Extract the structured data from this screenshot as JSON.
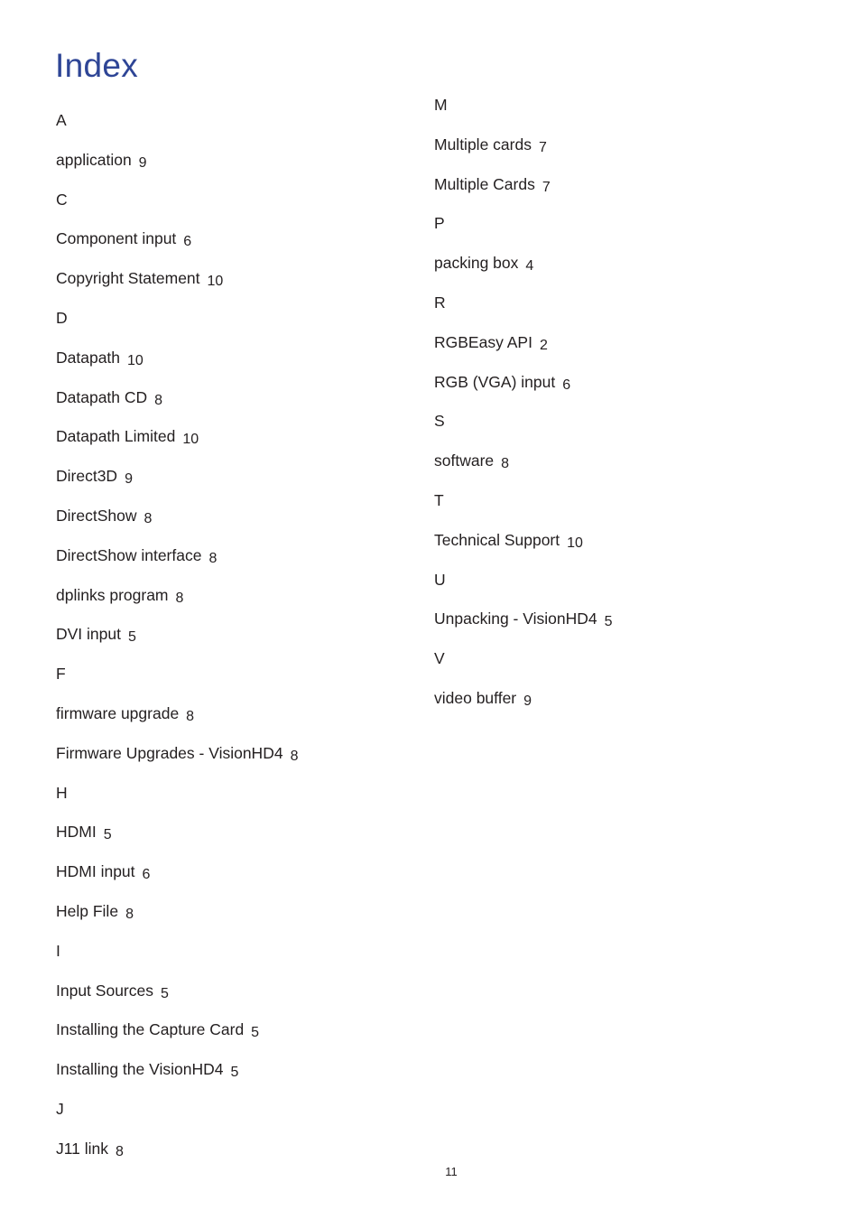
{
  "title": "Index",
  "page_number": "11",
  "columns": [
    {
      "entries": [
        {
          "type": "letter",
          "text": "A"
        },
        {
          "type": "term",
          "text": "application",
          "page": "9"
        },
        {
          "type": "letter",
          "text": "C"
        },
        {
          "type": "term",
          "text": "Component input",
          "page": "6"
        },
        {
          "type": "term",
          "text": "Copyright Statement",
          "page": "10"
        },
        {
          "type": "letter",
          "text": "D"
        },
        {
          "type": "term",
          "text": "Datapath",
          "page": "10"
        },
        {
          "type": "term",
          "text": "Datapath CD",
          "page": "8"
        },
        {
          "type": "term",
          "text": "Datapath Limited",
          "page": "10"
        },
        {
          "type": "term",
          "text": "Direct3D",
          "page": "9"
        },
        {
          "type": "term",
          "text": "DirectShow",
          "page": "8"
        },
        {
          "type": "term",
          "text": "DirectShow interface",
          "page": "8"
        },
        {
          "type": "term",
          "text": "dplinks program",
          "page": "8"
        },
        {
          "type": "term",
          "text": "DVI input",
          "page": "5"
        },
        {
          "type": "letter",
          "text": "F"
        },
        {
          "type": "term",
          "text": "firmware upgrade",
          "page": "8"
        },
        {
          "type": "term",
          "text": "Firmware Upgrades - VisionHD4",
          "page": "8"
        },
        {
          "type": "letter",
          "text": "H"
        },
        {
          "type": "term",
          "text": "HDMI",
          "page": "5"
        },
        {
          "type": "term",
          "text": "HDMI input",
          "page": "6"
        },
        {
          "type": "term",
          "text": "Help File",
          "page": "8"
        },
        {
          "type": "letter",
          "text": "I"
        },
        {
          "type": "term",
          "text": "Input Sources",
          "page": "5"
        },
        {
          "type": "term",
          "text": "Installing the Capture Card",
          "page": "5"
        },
        {
          "type": "term",
          "text": "Installing the VisionHD4",
          "page": "5"
        },
        {
          "type": "letter",
          "text": "J"
        },
        {
          "type": "term",
          "text": "J11 link",
          "page": "8"
        }
      ]
    },
    {
      "entries": [
        {
          "type": "letter",
          "text": "M"
        },
        {
          "type": "term",
          "text": "Multiple cards",
          "page": "7"
        },
        {
          "type": "term",
          "text": "Multiple Cards",
          "page": "7"
        },
        {
          "type": "letter",
          "text": "P"
        },
        {
          "type": "term",
          "text": "packing box",
          "page": "4"
        },
        {
          "type": "letter",
          "text": "R"
        },
        {
          "type": "term",
          "text": "RGBEasy API",
          "page": "2"
        },
        {
          "type": "term",
          "text": "RGB (VGA) input",
          "page": "6"
        },
        {
          "type": "letter",
          "text": "S"
        },
        {
          "type": "term",
          "text": "software",
          "page": "8"
        },
        {
          "type": "letter",
          "text": "T"
        },
        {
          "type": "term",
          "text": "Technical Support",
          "page": "10"
        },
        {
          "type": "letter",
          "text": "U"
        },
        {
          "type": "term",
          "text": "Unpacking - VisionHD4",
          "page": "5"
        },
        {
          "type": "letter",
          "text": "V"
        },
        {
          "type": "term",
          "text": "video buffer",
          "page": "9"
        }
      ]
    }
  ],
  "colors": {
    "title": "#2e4596",
    "text": "#231f20"
  }
}
